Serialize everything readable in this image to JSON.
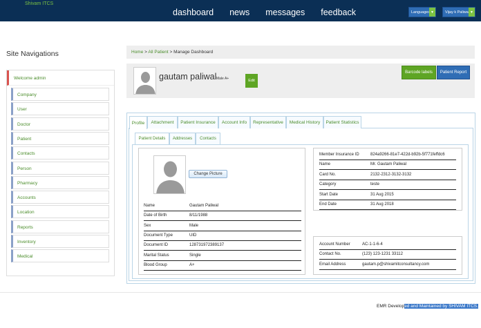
{
  "brand": "Shivam ITCS",
  "nav": [
    "dashboard",
    "news",
    "messages",
    "feedback"
  ],
  "top_buttons": {
    "languages": "Languages",
    "user": "Vijay k Paliwal"
  },
  "sidebar": {
    "title": "Site Navigations",
    "welcome": "Welcome admin",
    "items": [
      "Company",
      "User",
      "Doctor",
      "Patient",
      "Contacts",
      "Person",
      "Pharmacy",
      "Accounts",
      "Location",
      "Reports",
      "Inventory",
      "Medical"
    ]
  },
  "breadcrumb": {
    "home": "Home",
    "sep": ">",
    "all": "All Patient",
    "current": "Manage Dashboard"
  },
  "patient": {
    "name": "gautam paliwal",
    "meta": "Male A+"
  },
  "buttons": {
    "edit": "Edit",
    "barcode": "Barcode labels",
    "report": "Patient Report",
    "change_picture": "Change Picture"
  },
  "tabs": [
    "Profile",
    "Attachment",
    "Patient Insurance",
    "Account Info",
    "Representative",
    "Medical History",
    "Patient Statistics"
  ],
  "subtabs": [
    "Patient Details",
    "Addresses",
    "Contacts"
  ],
  "details": [
    {
      "k": "Name",
      "v": "Gautam Paliwal"
    },
    {
      "k": "Date of Birth",
      "v": "8/11/1988"
    },
    {
      "k": "Sex",
      "v": "Male"
    },
    {
      "k": "Document Type",
      "v": "UID"
    },
    {
      "k": "Document ID",
      "v": "128731972389137"
    },
    {
      "k": "Marital Status",
      "v": "Single"
    },
    {
      "k": "Blood Group",
      "v": "A+"
    }
  ],
  "insurance": [
    {
      "k": "Member Insurance ID",
      "v": "824a9266-81e7-422d-b92b-5f771feffdc6"
    },
    {
      "k": "Name",
      "v": "Mr. Gautam Paliwal"
    },
    {
      "k": "Card No.",
      "v": "2132-2312-3132-3132"
    },
    {
      "k": "Category",
      "v": "teste"
    },
    {
      "k": "Start Date",
      "v": "31 Aug 2015"
    },
    {
      "k": "End Date",
      "v": "31 Aug 2018"
    }
  ],
  "account": [
    {
      "k": "Account Number",
      "v": "AC-1-1-6-4"
    },
    {
      "k": "Contact No.",
      "v": "(123) 123-1231 33112"
    },
    {
      "k": "Email Address",
      "v": "gautam.p@shivamitconsultancy.com"
    }
  ],
  "footer": {
    "prefix": "EMR Develop",
    "highlight": "ed and Maintained by SHIVAM ITCS."
  },
  "colors": {
    "nav_bg": "#0b2f55",
    "green": "#5ea524",
    "blue": "#2f6db5",
    "link": "#4a8c2a"
  }
}
